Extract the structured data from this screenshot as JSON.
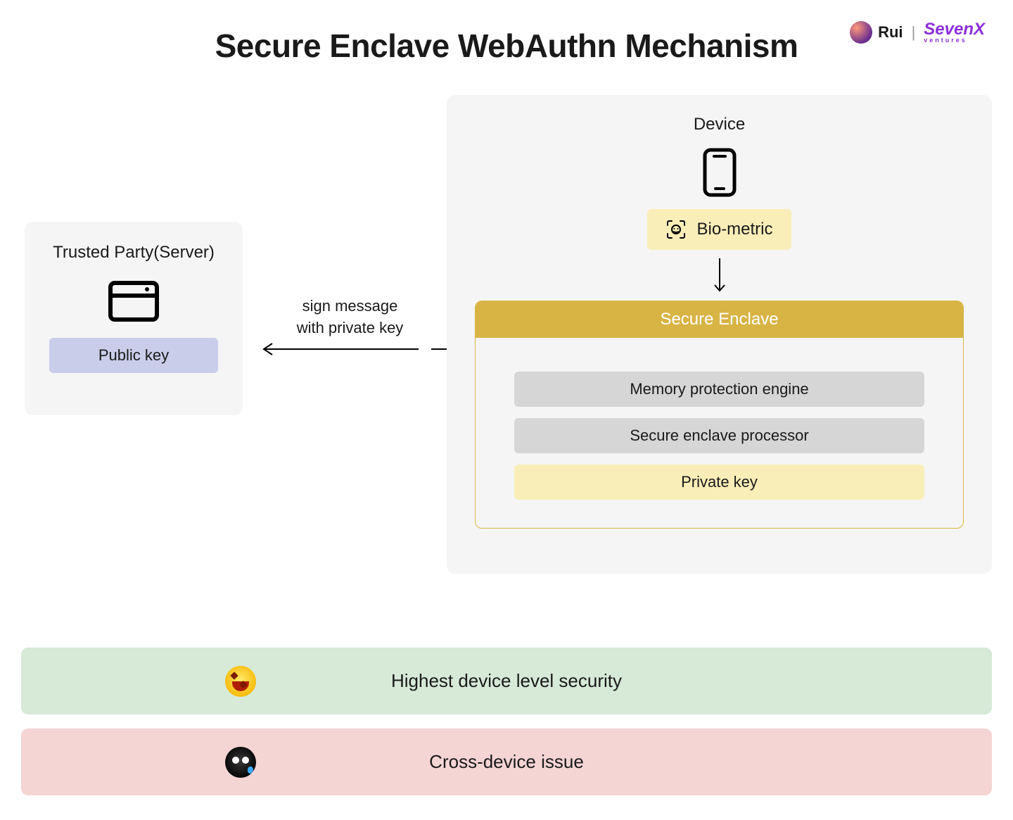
{
  "title": "Secure Enclave WebAuthn Mechanism",
  "branding": {
    "author": "Rui",
    "company_top": "SevenX",
    "company_bot": "ventures"
  },
  "server": {
    "label": "Trusted Party(Server)",
    "public_key": "Public key"
  },
  "arrow_label_line1": "sign message",
  "arrow_label_line2": "with private key",
  "device": {
    "label": "Device",
    "biometric": "Bio-metric",
    "enclave_header": "Secure Enclave",
    "rows": [
      "Memory protection engine",
      "Secure enclave processor",
      "Private key"
    ]
  },
  "banners": {
    "good": "Highest device level security",
    "bad": "Cross-device issue"
  },
  "colors": {
    "panel_grey": "#f5f5f6",
    "pubkey_blue": "#c9cde9",
    "biometric_yellow": "#f9eeb8",
    "enclave_gold": "#d8b445",
    "row_grey": "#d6d6d6",
    "banner_green": "#d6ead7",
    "banner_pink": "#f4d5d4"
  }
}
